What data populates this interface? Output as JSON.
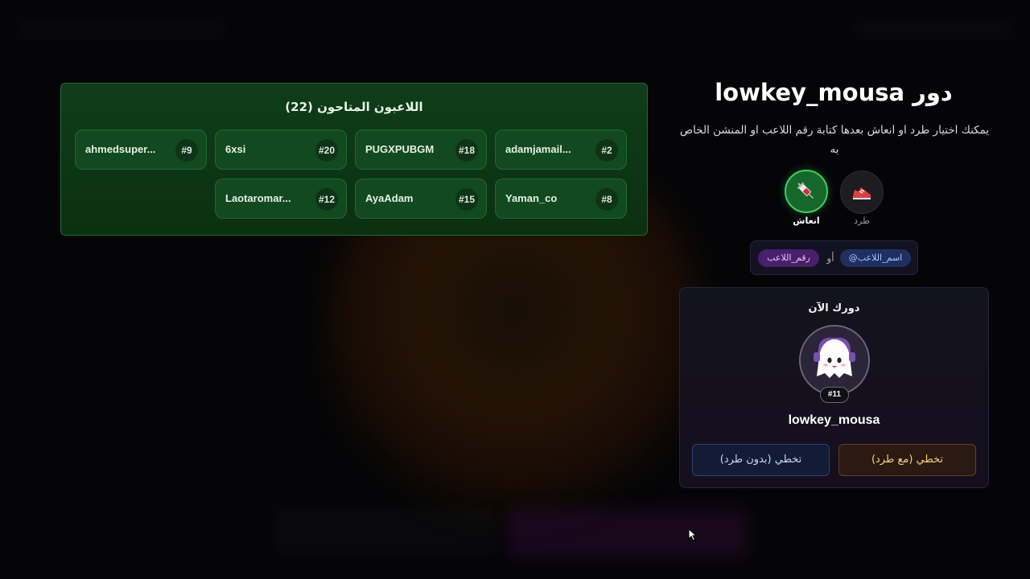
{
  "players_panel": {
    "title": "اللاعبون المتاحون (22)",
    "players": [
      {
        "number": "#2",
        "name": "adamjamail..."
      },
      {
        "number": "#18",
        "name": "PUGXPUBGM"
      },
      {
        "number": "#20",
        "name": "6xsi"
      },
      {
        "number": "#9",
        "name": "ahmedsuper..."
      },
      {
        "number": "#8",
        "name": "Yaman_co"
      },
      {
        "number": "#15",
        "name": "AyaAdam"
      },
      {
        "number": "#12",
        "name": "Laotaromar..."
      }
    ]
  },
  "turn": {
    "title": "دور lowkey_mousa",
    "instructions": "يمكنك اختيار طرد او انعاش بعدها كتابة رقم اللاعب او المنشن الخاص به"
  },
  "actions": {
    "kick_label": "طرد",
    "kick_icon": "sneaker-icon",
    "revive_label": "انعاش",
    "revive_icon": "syringe-icon"
  },
  "hint": {
    "mention_chip": "@اسم_اللاعب",
    "or": "أو",
    "number_chip": "رقم_اللاعب"
  },
  "current": {
    "title": "دورك الآن",
    "badge": "#11",
    "name": "lowkey_mousa",
    "skip_with_kick": "تخطي (مع طرد)",
    "skip_without_kick": "تخطي (بدون طرد)"
  },
  "colors": {
    "panel_green": "#0f3d19",
    "revive_green": "#3ccf5e",
    "skip_kick_text": "#ffcf7a",
    "skip_nokick_text": "#c7d6ff"
  }
}
